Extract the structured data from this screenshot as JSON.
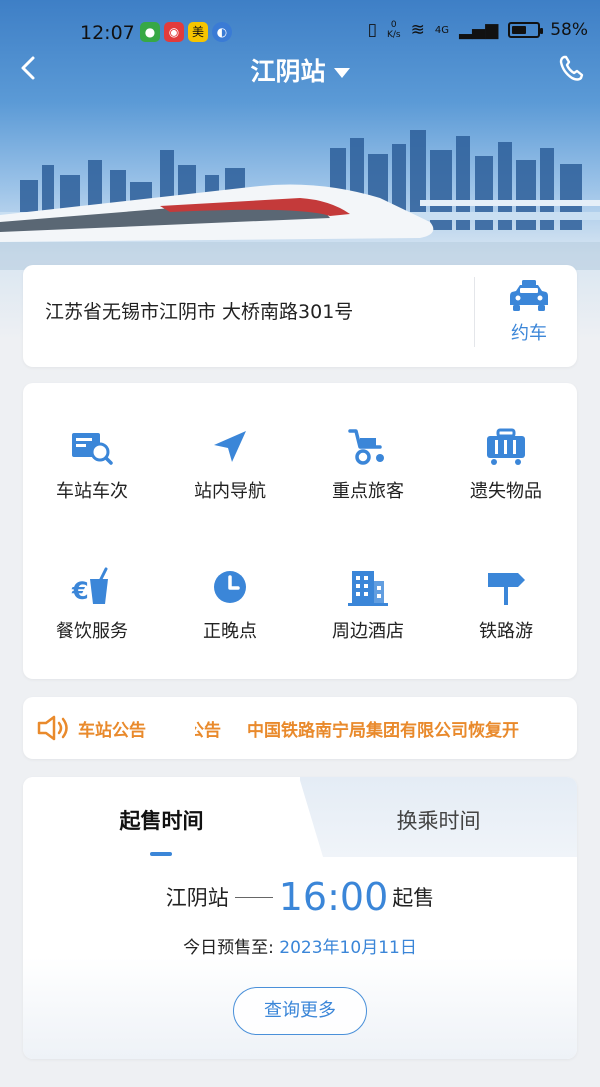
{
  "status_bar": {
    "time": "12:07",
    "speed_value": "0",
    "speed_unit": "K/s",
    "network": "4G",
    "battery": "58%",
    "battery_level": 0.58
  },
  "header": {
    "title": "江阴站",
    "back_icon": "chevron-left-icon",
    "phone_icon": "phone-icon"
  },
  "address": {
    "text": "江苏省无锡市江阴市 大桥南路301号",
    "taxi_icon": "taxi-icon",
    "taxi_label": "约车"
  },
  "services": [
    {
      "label": "车站车次",
      "icon": "train-search-icon"
    },
    {
      "label": "站内导航",
      "icon": "navigation-arrow-icon"
    },
    {
      "label": "重点旅客",
      "icon": "wheelchair-icon"
    },
    {
      "label": "遗失物品",
      "icon": "luggage-icon"
    },
    {
      "label": "餐饮服务",
      "icon": "drink-cup-icon"
    },
    {
      "label": "正晚点",
      "icon": "clock-icon"
    },
    {
      "label": "周边酒店",
      "icon": "hotel-building-icon"
    },
    {
      "label": "铁路游",
      "icon": "signpost-icon"
    }
  ],
  "notice": {
    "icon": "megaphone-icon",
    "label": "车站公告",
    "ghost_text": "公告",
    "message": "中国铁路南宁局集团有限公司恢复开"
  },
  "sales": {
    "tabs": [
      "起售时间",
      "换乘时间"
    ],
    "active_tab": 0,
    "station": "江阴站",
    "time": "16:00",
    "time_suffix": "起售",
    "presale_label": "今日预售至:",
    "presale_date": "2023年10月11日",
    "more_button": "查询更多"
  },
  "colors": {
    "accent": "#3b86d8",
    "notice": "#e98a2c"
  }
}
